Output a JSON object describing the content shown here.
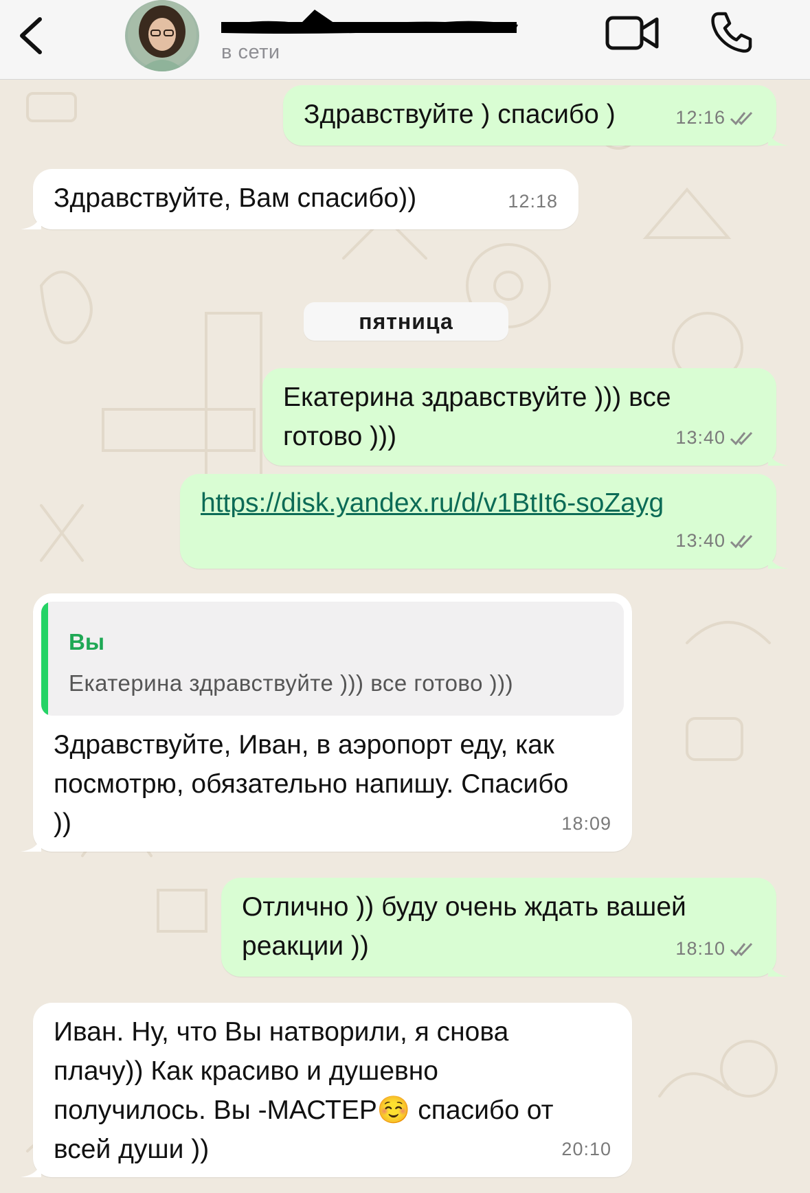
{
  "header": {
    "status": "в сети",
    "name_redacted": true
  },
  "messages": [
    {
      "direction": "out",
      "text": "Здравствуйте ) спасибо )",
      "time": "12:16",
      "status": "read"
    },
    {
      "direction": "in",
      "text": "Здравствуйте, Вам спасибо))",
      "time": "12:18"
    },
    {
      "direction": "out",
      "text": "Екатерина здравствуйте ))) все готово )))",
      "time": "13:40",
      "status": "read"
    },
    {
      "direction": "out",
      "text": "https://disk.yandex.ru/d/v1BtIt6-soZayg",
      "time": "13:40",
      "status": "read",
      "is_link": true
    },
    {
      "direction": "in",
      "reply_author": "Вы",
      "reply_text": "Екатерина здравствуйте ))) все готово )))",
      "text": "Здравствуйте, Иван, в аэропорт еду, как посмотрю, обязательно напишу. Спасибо ))",
      "time": "18:09"
    },
    {
      "direction": "out",
      "text": "Отлично )) буду очень ждать вашей реакции ))",
      "time": "18:10",
      "status": "read"
    },
    {
      "direction": "in",
      "text": "Иван. Ну, что Вы натворили, я снова плачу)) Как красиво и душевно получилось. Вы -МАСТЕР☺️ спасибо от всей души ))",
      "time": "20:10"
    }
  ],
  "day_separator": "пятница",
  "icons": [
    "back-chevron-icon",
    "video-call-icon",
    "phone-call-icon",
    "double-check-icon",
    "smiling-face-emoji"
  ],
  "colors": {
    "outgoing_bubble": "#d9fdd3",
    "incoming_bubble": "#ffffff",
    "chat_background": "#efe9df",
    "reply_accent": "#25d366",
    "link": "#0c6b56"
  }
}
